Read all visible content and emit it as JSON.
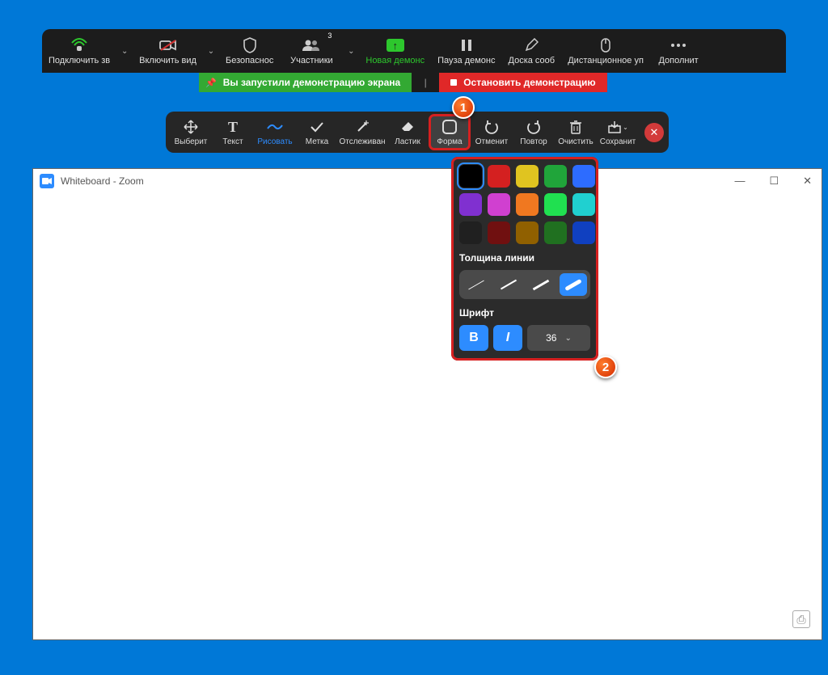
{
  "meeting": {
    "audio": "Подключить зв",
    "video": "Включить вид",
    "security": "Безопаснос",
    "participants": "Участники",
    "participants_count": "3",
    "new_share": "Новая демонс",
    "pause_share": "Пауза демонс",
    "whiteboard": "Доска сооб",
    "remote": "Дистанционное уп",
    "more": "Дополнит"
  },
  "share": {
    "started": "Вы запустили демонстрацию экрана",
    "stop": "Остановить демонстрацию"
  },
  "anno": {
    "select": "Выберит",
    "text": "Текст",
    "draw": "Рисовать",
    "stamp": "Метка",
    "spotlight": "Отслеживан",
    "eraser": "Ластик",
    "format": "Форма",
    "undo": "Отменит",
    "redo": "Повтор",
    "clear": "Очистить",
    "save": "Сохранит"
  },
  "format": {
    "colors_row1": [
      "#000000",
      "#d42020",
      "#e0c420",
      "#20a53a",
      "#2d6cff"
    ],
    "colors_row2": [
      "#8030d0",
      "#d040d0",
      "#f07820",
      "#20e050",
      "#20d0d0"
    ],
    "colors_row3": [
      "#202020",
      "#701010",
      "#906000",
      "#207020",
      "#1040c0"
    ],
    "selected_index": 0,
    "thickness_label": "Толщина линии",
    "thickness_selected": 3,
    "font_label": "Шрифт",
    "bold": "B",
    "italic": "I",
    "font_size": "36"
  },
  "wb": {
    "title": "Whiteboard - Zoom"
  },
  "markers": {
    "one": "1",
    "two": "2"
  }
}
